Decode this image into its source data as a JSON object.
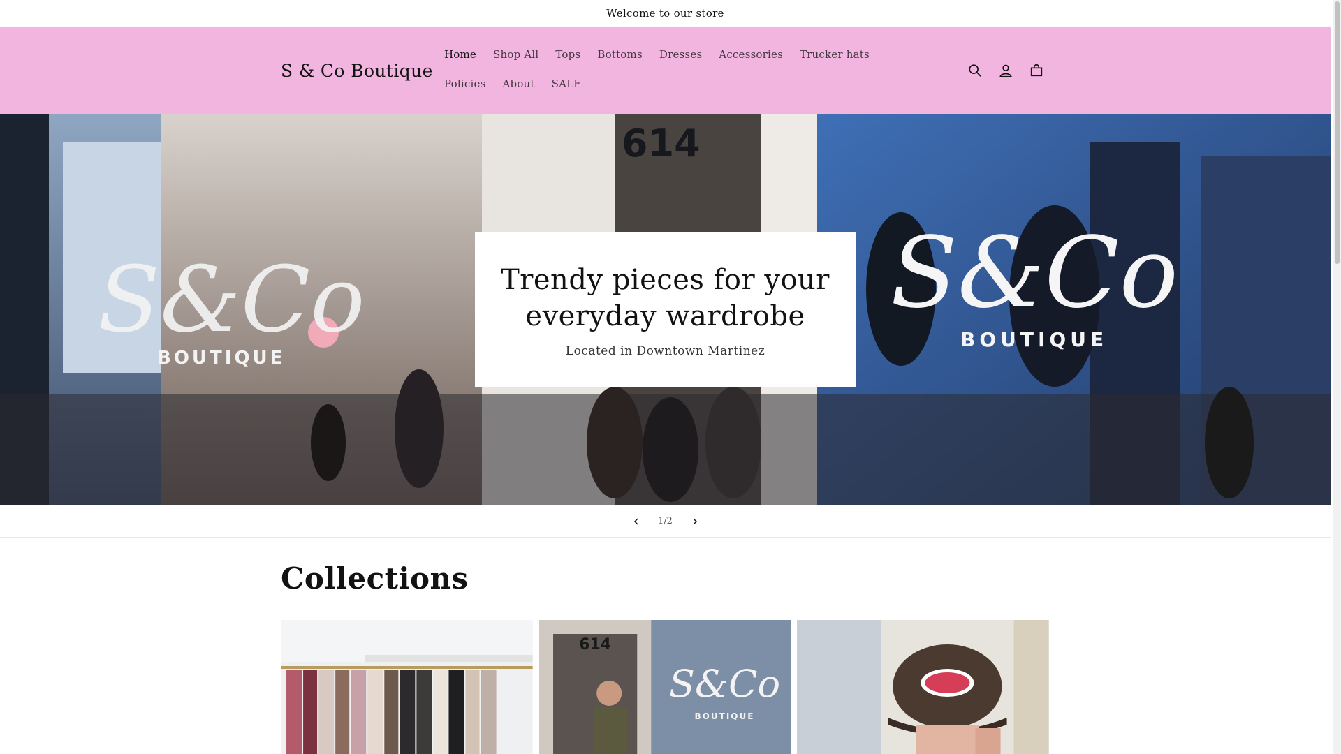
{
  "announcement": {
    "text": "Welcome to our store"
  },
  "header": {
    "logo": "S & Co Boutique",
    "nav": [
      {
        "label": "Home",
        "active": true
      },
      {
        "label": "Shop All"
      },
      {
        "label": "Tops"
      },
      {
        "label": "Bottoms"
      },
      {
        "label": "Dresses"
      },
      {
        "label": "Accessories"
      },
      {
        "label": "Trucker hats"
      },
      {
        "label": "Policies"
      },
      {
        "label": "About"
      },
      {
        "label": "SALE"
      }
    ],
    "icons": [
      "search-icon",
      "account-icon",
      "cart-icon"
    ],
    "background_color": "#f2b5e0"
  },
  "hero": {
    "title": "Trendy pieces for your everyday wardrobe",
    "subtitle": "Located in Downtown Martinez",
    "window_sign": "S&Co",
    "window_sign_sub": "BOUTIQUE",
    "address_number": "614"
  },
  "slider": {
    "counter": "1/2"
  },
  "collections": {
    "title": "Collections"
  }
}
